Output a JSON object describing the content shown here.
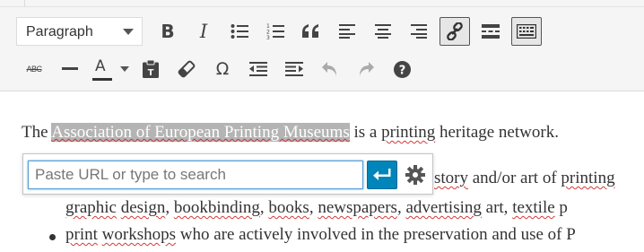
{
  "editor": {
    "format_select": {
      "value": "Paragraph"
    }
  },
  "toolbar": {
    "row1": [
      "bold",
      "italic",
      "bulleted-list",
      "numbered-list",
      "blockquote",
      "align-left",
      "align-center",
      "align-right",
      "insert-link",
      "read-more",
      "toolbar-toggle"
    ],
    "row2": [
      "strikethrough",
      "horizontal-line",
      "text-color",
      "paste-as-text",
      "clear-formatting",
      "special-character",
      "decrease-indent",
      "increase-indent",
      "undo",
      "redo",
      "keyboard-shortcuts"
    ],
    "labels": {
      "bold": "B",
      "italic": "I",
      "strike": "ABC",
      "text_color": "A",
      "special_char": "Ω"
    },
    "active_button": "insert-link"
  },
  "content": {
    "para1": {
      "before": "The ",
      "selected": "Association of European Printing Museums",
      "after_1": " is a ",
      "after_2": "printing",
      "after_3": " heritage network."
    },
    "line1": {
      "p1": "story",
      "p2": " and/or art of ",
      "p3": "printing"
    },
    "line2": {
      "p1": "graphic",
      "p2": " ",
      "p3": "design",
      "p4": ", ",
      "p5": "bookbinding",
      "p6": ", ",
      "p7": "books",
      "p8": ", ",
      "p9": "newspapers",
      "p10": ", ",
      "p11": "advertising",
      "p12": " art, ",
      "p13": "textile",
      "p14": " p"
    },
    "line3": {
      "p1": "print",
      "p2": " ",
      "p3": "workshops",
      "p4": " who are actively involved in the preservation and use of P"
    }
  },
  "link_popup": {
    "placeholder": "Paste URL or type to search",
    "value": "",
    "apply_icon": "return-arrow-icon",
    "settings_icon": "gear-icon"
  },
  "colors": {
    "accent": "#0085ba",
    "selection": "#b4b4b4",
    "spellcheck": "#d43a3a"
  }
}
